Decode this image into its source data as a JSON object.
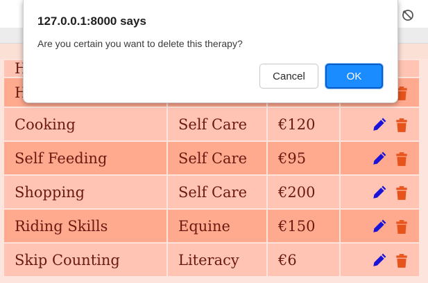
{
  "dialog": {
    "title": "127.0.0.1:8000 says",
    "message": "Are you certain you want to delete this therapy?",
    "cancel_label": "Cancel",
    "ok_label": "OK"
  },
  "table": {
    "partial_row": {
      "name": "Hi",
      "category": "",
      "price": ""
    },
    "rows": [
      {
        "name": "Cooking",
        "category": "Self Care",
        "price": "€120"
      },
      {
        "name": "Self Feeding",
        "category": "Self Care",
        "price": "€95"
      },
      {
        "name": "Shopping",
        "category": "Self Care",
        "price": "€200"
      },
      {
        "name": "Riding Skills",
        "category": "Equine",
        "price": "€150"
      },
      {
        "name": "Skip Counting",
        "category": "Literacy",
        "price": "€6"
      }
    ]
  },
  "icons": {
    "edit": "pencil-icon",
    "delete": "trash-icon",
    "browser": "sync-icon"
  },
  "colors": {
    "row_light": "#ffc4b4",
    "row_dark": "#ffa98f",
    "text": "#6a1a10",
    "edit_icon": "#1a14d9",
    "delete_icon": "#e6541c",
    "ok_button": "#1a8cff"
  }
}
